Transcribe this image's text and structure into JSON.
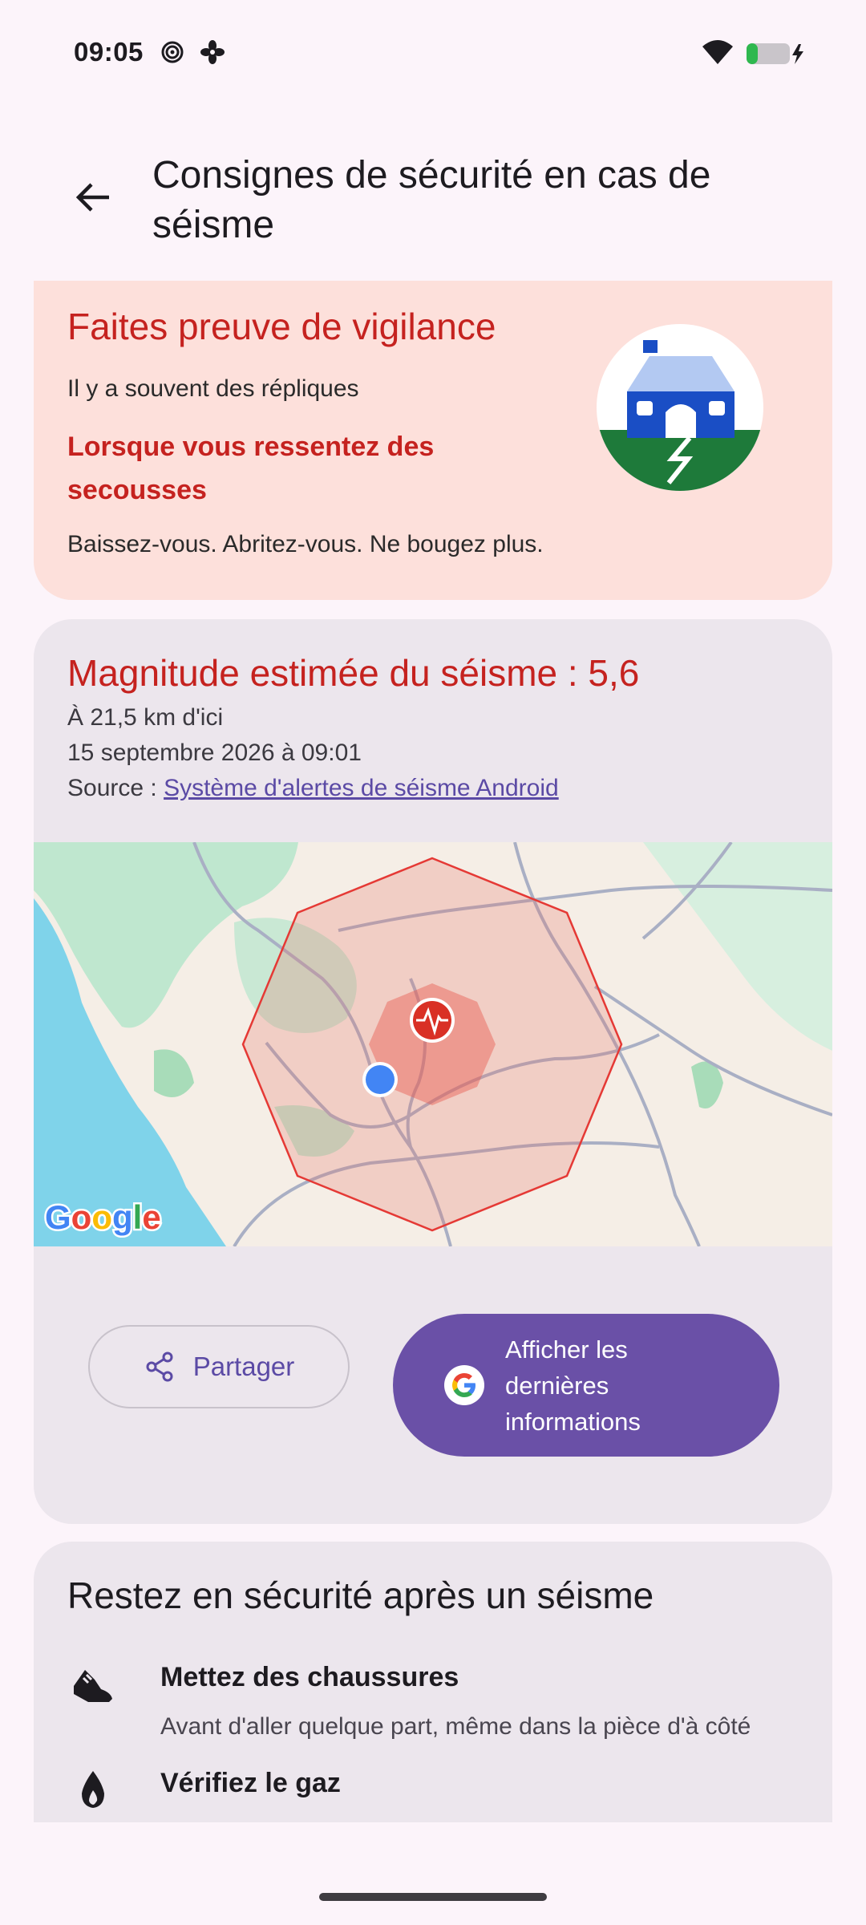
{
  "status_bar": {
    "time": "09:05",
    "left_icons": [
      "hotspot-icon",
      "fan-icon"
    ],
    "right_icons": [
      "wifi-icon",
      "battery-charging-icon"
    ],
    "battery_level": 0.25
  },
  "header": {
    "title": "Consignes de sécurité en cas de séisme"
  },
  "alert_card": {
    "title": "Faites preuve de vigilance",
    "subtitle": "Il y a souvent des répliques",
    "heading": "Lorsque vous ressentez des secousses",
    "instruction": "Baissez-vous. Abritez-vous. Ne bougez plus.",
    "illustration": "house-earthquake-icon"
  },
  "quake_card": {
    "title": "Magnitude estimée du séisme : 5,6",
    "distance": "À 21,5 km d'ici",
    "datetime": "15 septembre 2026 à 09:01",
    "source_label": "Source : ",
    "source_link": "Système d'alertes de séisme Android",
    "map_logo": "Google",
    "share_label": "Partager",
    "latest_label": "Afficher les dernières informations"
  },
  "safety_card": {
    "title": "Restez en sécurité après un séisme",
    "tips": [
      {
        "icon": "shoe-icon",
        "title": "Mettez des chaussures",
        "desc": "Avant d'aller quelque part, même dans la pièce d'à côté"
      },
      {
        "icon": "gas-flame-icon",
        "title": "Vérifiez le gaz",
        "desc": ""
      }
    ]
  },
  "colors": {
    "alert_red": "#c5221f",
    "accent_purple": "#6a50a7",
    "alert_bg": "#fde0db",
    "card_bg": "#ece6ed"
  }
}
